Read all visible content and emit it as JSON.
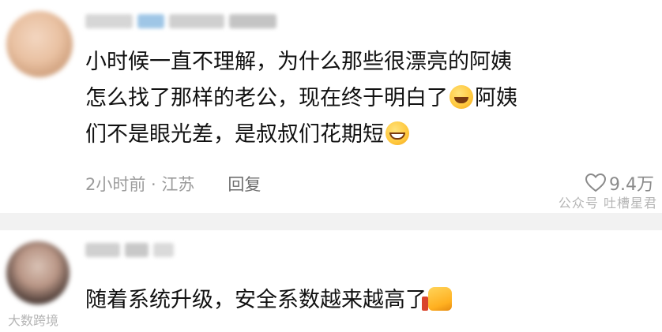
{
  "comments": [
    {
      "text_lines": [
        "小时候一直不理解，为什么那些很漂亮的阿姨",
        "怎么找了那样的老公，现在终于明白了",
        "阿姨",
        "们不是眼光差，是叔叔们花期短"
      ],
      "time_location": "2小时前 · 江苏",
      "reply_label": "回复",
      "likes": "9.4万"
    },
    {
      "text": "随着系统升级，安全系数越来越高了"
    }
  ],
  "watermark": {
    "right_text": "公众号 吐槽星君",
    "bottom_left_text": "大数跨境"
  },
  "icons": {
    "laugh_emoji": "rolling-laughing-emoji",
    "grin_emoji": "grinning-emoji",
    "thumb_emoji": "thumbs-up-emoji",
    "like_icon": "heart-icon"
  }
}
